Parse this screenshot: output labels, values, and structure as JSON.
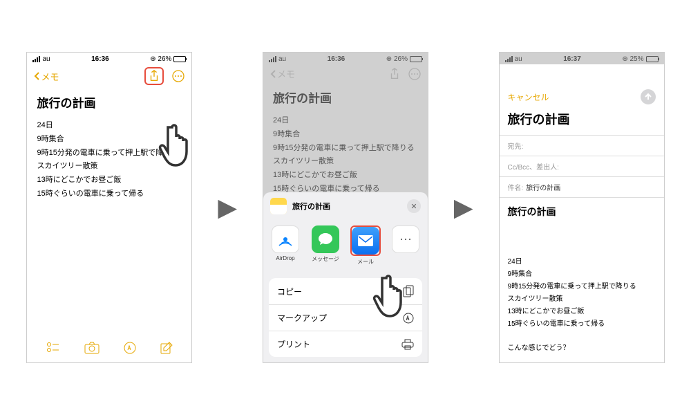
{
  "status": {
    "carrier": "au",
    "time": "16:36",
    "time3": "16:37",
    "battery1": "26%",
    "battery2": "26%",
    "battery3": "25%"
  },
  "nav": {
    "back": "メモ"
  },
  "note": {
    "title": "旅行の計画",
    "lines": [
      "24日",
      "9時集合",
      "9時15分発の電車に乗って押上駅で降りる",
      "スカイツリー散策",
      "13時にどこかでお昼ご飯",
      "15時ぐらいの電車に乗って帰る"
    ]
  },
  "share": {
    "title": "旅行の計画",
    "apps": {
      "airdrop": "AirDrop",
      "messages": "メッセージ",
      "mail": "メール"
    },
    "actions": {
      "copy": "コピー",
      "markup": "マークアップ",
      "print": "プリント"
    }
  },
  "compose": {
    "cancel": "キャンセル",
    "title": "旅行の計画",
    "to": "宛先:",
    "ccbcc": "Cc/Bcc、差出人:",
    "subject_label": "件名:",
    "subject": "旅行の計画",
    "body_title": "旅行の計画",
    "body": [
      "24日",
      "9時集合",
      "9時15分発の電車に乗って押上駅で降りる",
      "スカイツリー散策",
      "13時にどこかでお昼ご飯",
      "15時ぐらいの電車に乗って帰る"
    ],
    "footer": "こんな感じでどう？"
  }
}
